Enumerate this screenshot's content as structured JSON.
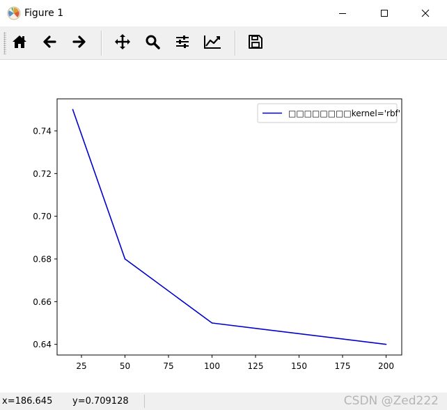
{
  "window": {
    "title": "Figure 1",
    "app_icon": "matplotlib-figure-icon",
    "controls": [
      "minimize-icon",
      "maximize-icon",
      "close-icon"
    ]
  },
  "toolbar": {
    "buttons": [
      {
        "name": "home-button",
        "icon": "home-icon"
      },
      {
        "name": "back-button",
        "icon": "arrow-left-icon"
      },
      {
        "name": "forward-button",
        "icon": "arrow-right-icon"
      },
      {
        "name": "pan-button",
        "icon": "move-icon"
      },
      {
        "name": "zoom-button",
        "icon": "magnifier-icon"
      },
      {
        "name": "subplots-button",
        "icon": "sliders-icon"
      },
      {
        "name": "edit-axes-button",
        "icon": "line-chart-icon"
      },
      {
        "name": "save-button",
        "icon": "floppy-disk-icon"
      }
    ]
  },
  "status": {
    "x_readout": "x=186.645",
    "y_readout": "y=0.709128"
  },
  "watermark": "CSDN @Zed222",
  "colors": {
    "series": "#0000cc",
    "toolbar_bg": "#f0f0f0",
    "axes_edge": "#000000"
  },
  "chart_data": {
    "type": "line",
    "x": [
      20,
      50,
      100,
      200
    ],
    "series": [
      {
        "name": "□□□□□□□□kernel='rbf'",
        "values": [
          0.75,
          0.68,
          0.65,
          0.64
        ]
      }
    ],
    "title": "",
    "xlabel": "",
    "ylabel": "",
    "xlim": [
      11,
      209
    ],
    "ylim": [
      0.635,
      0.755
    ],
    "xticks": [
      25,
      50,
      75,
      100,
      125,
      150,
      175,
      200
    ],
    "xtick_labels": [
      "25",
      "50",
      "75",
      "100",
      "125",
      "150",
      "175",
      "200"
    ],
    "yticks": [
      0.64,
      0.66,
      0.68,
      0.7,
      0.72,
      0.74
    ],
    "ytick_labels": [
      "0.64",
      "0.66",
      "0.68",
      "0.70",
      "0.72",
      "0.74"
    ],
    "legend": "upper-right",
    "grid": false
  }
}
